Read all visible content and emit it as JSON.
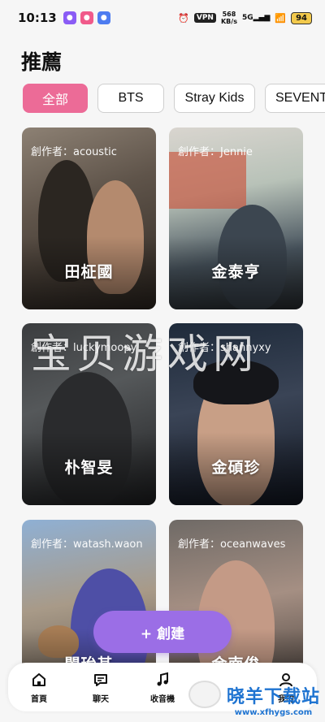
{
  "status": {
    "time": "10:13",
    "vpn": "VPN",
    "net_speed": "568",
    "net_unit": "KB/s",
    "signal": "5G",
    "battery": "94"
  },
  "page_title": "推薦",
  "tabs": [
    {
      "label": "全部",
      "active": true
    },
    {
      "label": "BTS",
      "active": false
    },
    {
      "label": "Stray Kids",
      "active": false
    },
    {
      "label": "SEVENTE",
      "active": false
    }
  ],
  "cards": [
    {
      "creator": "創作者：acoustic",
      "name": "田柾國"
    },
    {
      "creator": "創作者：Jennie",
      "name": "金泰亨"
    },
    {
      "creator": "創作者：luckymoopy",
      "name": "朴智旻"
    },
    {
      "creator": "創作者：shannyxy",
      "name": "金碩珍"
    },
    {
      "creator": "創作者：watash.waon",
      "name": "閔玧其"
    },
    {
      "creator": "創作者：oceanwaves",
      "name": "金南俊"
    }
  ],
  "watermark": "宝贝游戏网",
  "create_button": "+ 創建",
  "nav": [
    {
      "label": "首頁",
      "icon": "home-icon"
    },
    {
      "label": "聊天",
      "icon": "chat-icon"
    },
    {
      "label": "收音機",
      "icon": "music-icon"
    },
    {
      "label": "",
      "icon": "sheep-icon"
    },
    {
      "label": "我的",
      "icon": "profile-icon"
    }
  ],
  "corner_logo": {
    "big": "晓羊下载站",
    "small": "www.xfhygs.com"
  },
  "colors": {
    "accent_pink": "#ec6b97",
    "accent_purple": "#9b6ee6",
    "logo_blue": "#1f74d1"
  }
}
